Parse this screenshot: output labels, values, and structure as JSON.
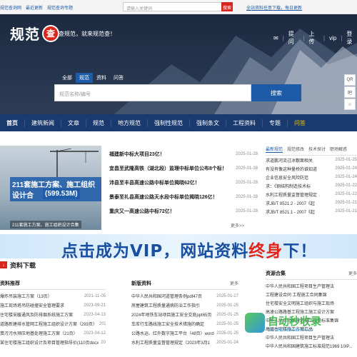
{
  "topbar": {
    "links": [
      "规范查询网",
      "最近更新",
      "规范查询专题"
    ],
    "search_placeholder": "请输入关键词",
    "search_button": "搜索",
    "notice": "全站资料任意下载，每日更新"
  },
  "hero": {
    "logo_text": "规范",
    "logo_seal": "查",
    "slogan": "查规范，就来规范查！",
    "user_links": [
      "提问",
      "上传",
      "vip",
      "登录"
    ],
    "tabs": [
      "全部",
      "规范",
      "资料",
      "问答"
    ],
    "active_tab": "规范",
    "search_placeholder": "规范名称/编号",
    "search_button": "搜索",
    "side_tools": [
      "QR",
      "吧",
      "☆"
    ]
  },
  "nav": {
    "items": [
      "首页",
      "建筑新闻",
      "文章",
      "规范",
      "地方规范",
      "强制性规范",
      "强制条文",
      "工程资料",
      "专题",
      "问答"
    ]
  },
  "banner": {
    "title_line": "211套施工方案、施工组织设计合",
    "price": "(599.53M)",
    "caption": "211套施工方案、施工组织设计合集"
  },
  "news": {
    "rows": [
      {
        "title": "福建新中标大项目23亿！",
        "date": "2025-01-28"
      },
      {
        "title": "宜昌至武隆高铁（湖北段）监理中标单位公布8个标！",
        "date": "2025-01-28"
      },
      {
        "title": "沛县至丰县高速公路中标单位揭晓62亿！",
        "date": "2025-01-28"
      },
      {
        "title": "景泰至礼县高速公路天水段中标单位揭晓126亿！",
        "date": "2025-01-28"
      },
      {
        "title": "重庆又一高速公路中标72亿！",
        "date": "2025-01-28"
      }
    ],
    "more": "更多>>"
  },
  "right_news": {
    "tabs": [
      "最新规范",
      "规范修改",
      "技术探讨",
      "职场解惑"
    ],
    "rows": [
      {
        "title": "求道鹏河流过冰敷面相关",
        "date": "2025-01-25"
      },
      {
        "title": "有没有像这种量桥的谁知道",
        "date": "2025-01-24"
      },
      {
        "title": "企业信息安全风险防范",
        "date": "2025-01-24"
      },
      {
        "title": "求：《钢结构制造技术标",
        "date": "2025-01-22"
      },
      {
        "title": "水利工程质量监督管理规定",
        "date": "2025-01-22"
      },
      {
        "title": "求JB/T 8521.2 - 2007《起",
        "date": "2025-01-21"
      },
      {
        "title": "求JB/T 8521.1 - 2007《起",
        "date": "2025-01-21"
      }
    ]
  },
  "vip_banner": {
    "part1": "点击成为VIP，网站资料",
    "part2": "终身",
    "part3": "下！"
  },
  "resources": {
    "title": "资料下载",
    "col1": {
      "header": "资料推荐",
      "rows": [
        {
          "title": "爆炸吊装施工方案（13页）",
          "date": "2021-11-05"
        },
        {
          "title": "施工现场塔吊防碰撞安全管理要求",
          "date": "2023-09-21"
        },
        {
          "title": "住宅楼采暖通风及防排烟系统施工方案",
          "date": "2023-04-13"
        },
        {
          "title": "道路新建排水管网工程施工组织设计方案（293页）",
          "date": "2021-12-21"
        },
        {
          "title": "粪污污水预压地基处理施工方案（21页）",
          "date": "2023-04-12"
        },
        {
          "title": "某住宅楼施工组织设计及项目管理指导价(110页docx",
          "date": "2023-09-01"
        }
      ]
    },
    "col2": {
      "header": "新版资料",
      "more": "更多",
      "rows": [
        {
          "title": "中华人民共和国河道管理条例pdf47页",
          "date": "2025-01-27"
        },
        {
          "title": "房屋建筑工程质量通病防治工作指引",
          "date": "2025-01-25"
        },
        {
          "title": "2024年地铁车站项目施工安全交底ppt65页",
          "date": "2025-01-25"
        },
        {
          "title": "车库行车路线施工安全技术措施的确定",
          "date": "2025-01-25"
        },
        {
          "title": "公路水运、红外数字施工平台（48页）word",
          "date": "2025-01-25"
        },
        {
          "title": "水利工程质量监督管理规定（2023年3月1",
          "date": "2025-01-24"
        }
      ]
    },
    "col3": {
      "header": "资源合集",
      "more": "更多",
      "rows": [
        "中华人民共和国工程项目生产管理法",
        "工程建设合同 工程施工合同集锦",
        "住宅楼安全文明施工组织与施工现场",
        "高速公路路基工程施工施工设计方案",
        "中华人民共和国建筑施工规范标准集锦",
        "高层住宅楼施工方案汇总",
        "中华人民共和国工程项目生产管理法",
        "中华人民共和国建筑施工标准规范1969 10ΙP..."
      ]
    }
  },
  "watermark": {
    "text": "自动秒收录",
    "sub": "ZIDONGMIAOSHOULU"
  }
}
